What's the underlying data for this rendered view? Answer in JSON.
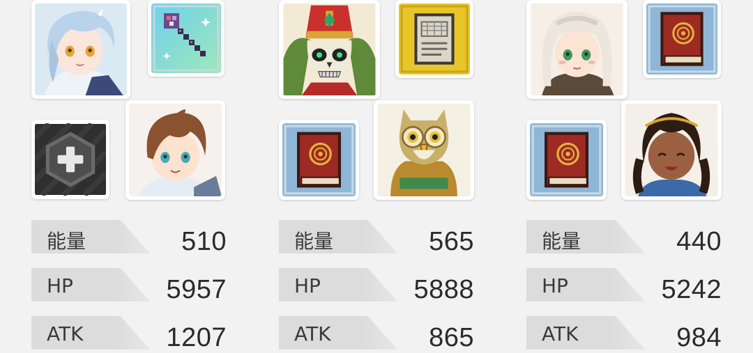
{
  "teams": [
    {
      "leader": "silver-haired-girl-portrait",
      "equip": "pixel-magic-staff-icon",
      "support": "add-slot-icon",
      "partner": "brown-haired-boy-portrait",
      "stats": [
        {
          "label": "能量",
          "value": "510"
        },
        {
          "label": "HP",
          "value": "5957"
        },
        {
          "label": "ATK",
          "value": "1207"
        }
      ]
    },
    {
      "leader": "skeleton-bishop-portrait",
      "equip": "pixel-stone-tablet-icon",
      "support": "pixel-red-book-icon",
      "partner": "owl-portrait",
      "stats": [
        {
          "label": "能量",
          "value": "565"
        },
        {
          "label": "HP",
          "value": "5888"
        },
        {
          "label": "ATK",
          "value": "865"
        }
      ]
    },
    {
      "leader": "white-haired-girl-portrait",
      "equip": "pixel-red-book-icon",
      "support": "pixel-red-book-icon",
      "partner": "braided-hair-girl-portrait",
      "stats": [
        {
          "label": "能量",
          "value": "440"
        },
        {
          "label": "HP",
          "value": "5242"
        },
        {
          "label": "ATK",
          "value": "984"
        }
      ]
    }
  ],
  "colors": {
    "background": "#f2f2f2",
    "stat_tab": "#dcdcdc",
    "text": "#2a2a2a"
  }
}
